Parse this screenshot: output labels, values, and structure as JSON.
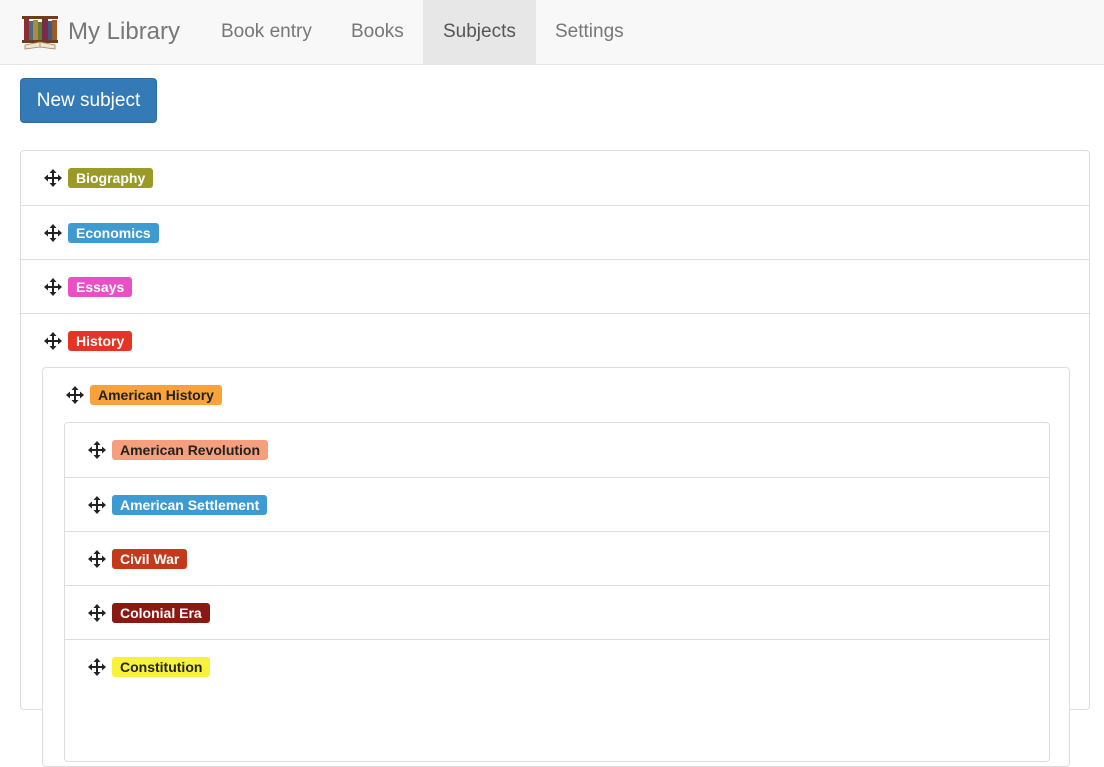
{
  "app": {
    "brand_title": "My Library",
    "brand_icon": "bookshelf-logo-icon"
  },
  "nav": {
    "items": [
      {
        "label": "Book entry"
      },
      {
        "label": "Books"
      },
      {
        "label": "Subjects",
        "active": true
      },
      {
        "label": "Settings"
      }
    ]
  },
  "toolbar": {
    "new_subject_label": "New subject"
  },
  "subjects": {
    "drag_icon": "move-arrows-icon",
    "top_level": [
      {
        "name": "Biography",
        "color": "#9a9a27",
        "text_color": "#ffffff"
      },
      {
        "name": "Economics",
        "color": "#3e9bd1",
        "text_color": "#ffffff"
      },
      {
        "name": "Essays",
        "color": "#ea4fc5",
        "text_color": "#ffffff"
      },
      {
        "name": "History",
        "color": "#e53424",
        "text_color": "#ffffff"
      }
    ],
    "history_children": [
      {
        "name": "American History",
        "color": "#f7a23a",
        "text_color": "#222222"
      }
    ],
    "american_history_children": [
      {
        "name": "American Revolution",
        "color": "#f59f7d",
        "text_color": "#222222"
      },
      {
        "name": "American Settlement",
        "color": "#3e9bd1",
        "text_color": "#ffffff"
      },
      {
        "name": "Civil War",
        "color": "#c23a1b",
        "text_color": "#ffffff"
      },
      {
        "name": "Colonial Era",
        "color": "#8a1912",
        "text_color": "#ffffff"
      },
      {
        "name": "Constitution",
        "color": "#f9f23a",
        "text_color": "#222222"
      }
    ]
  }
}
